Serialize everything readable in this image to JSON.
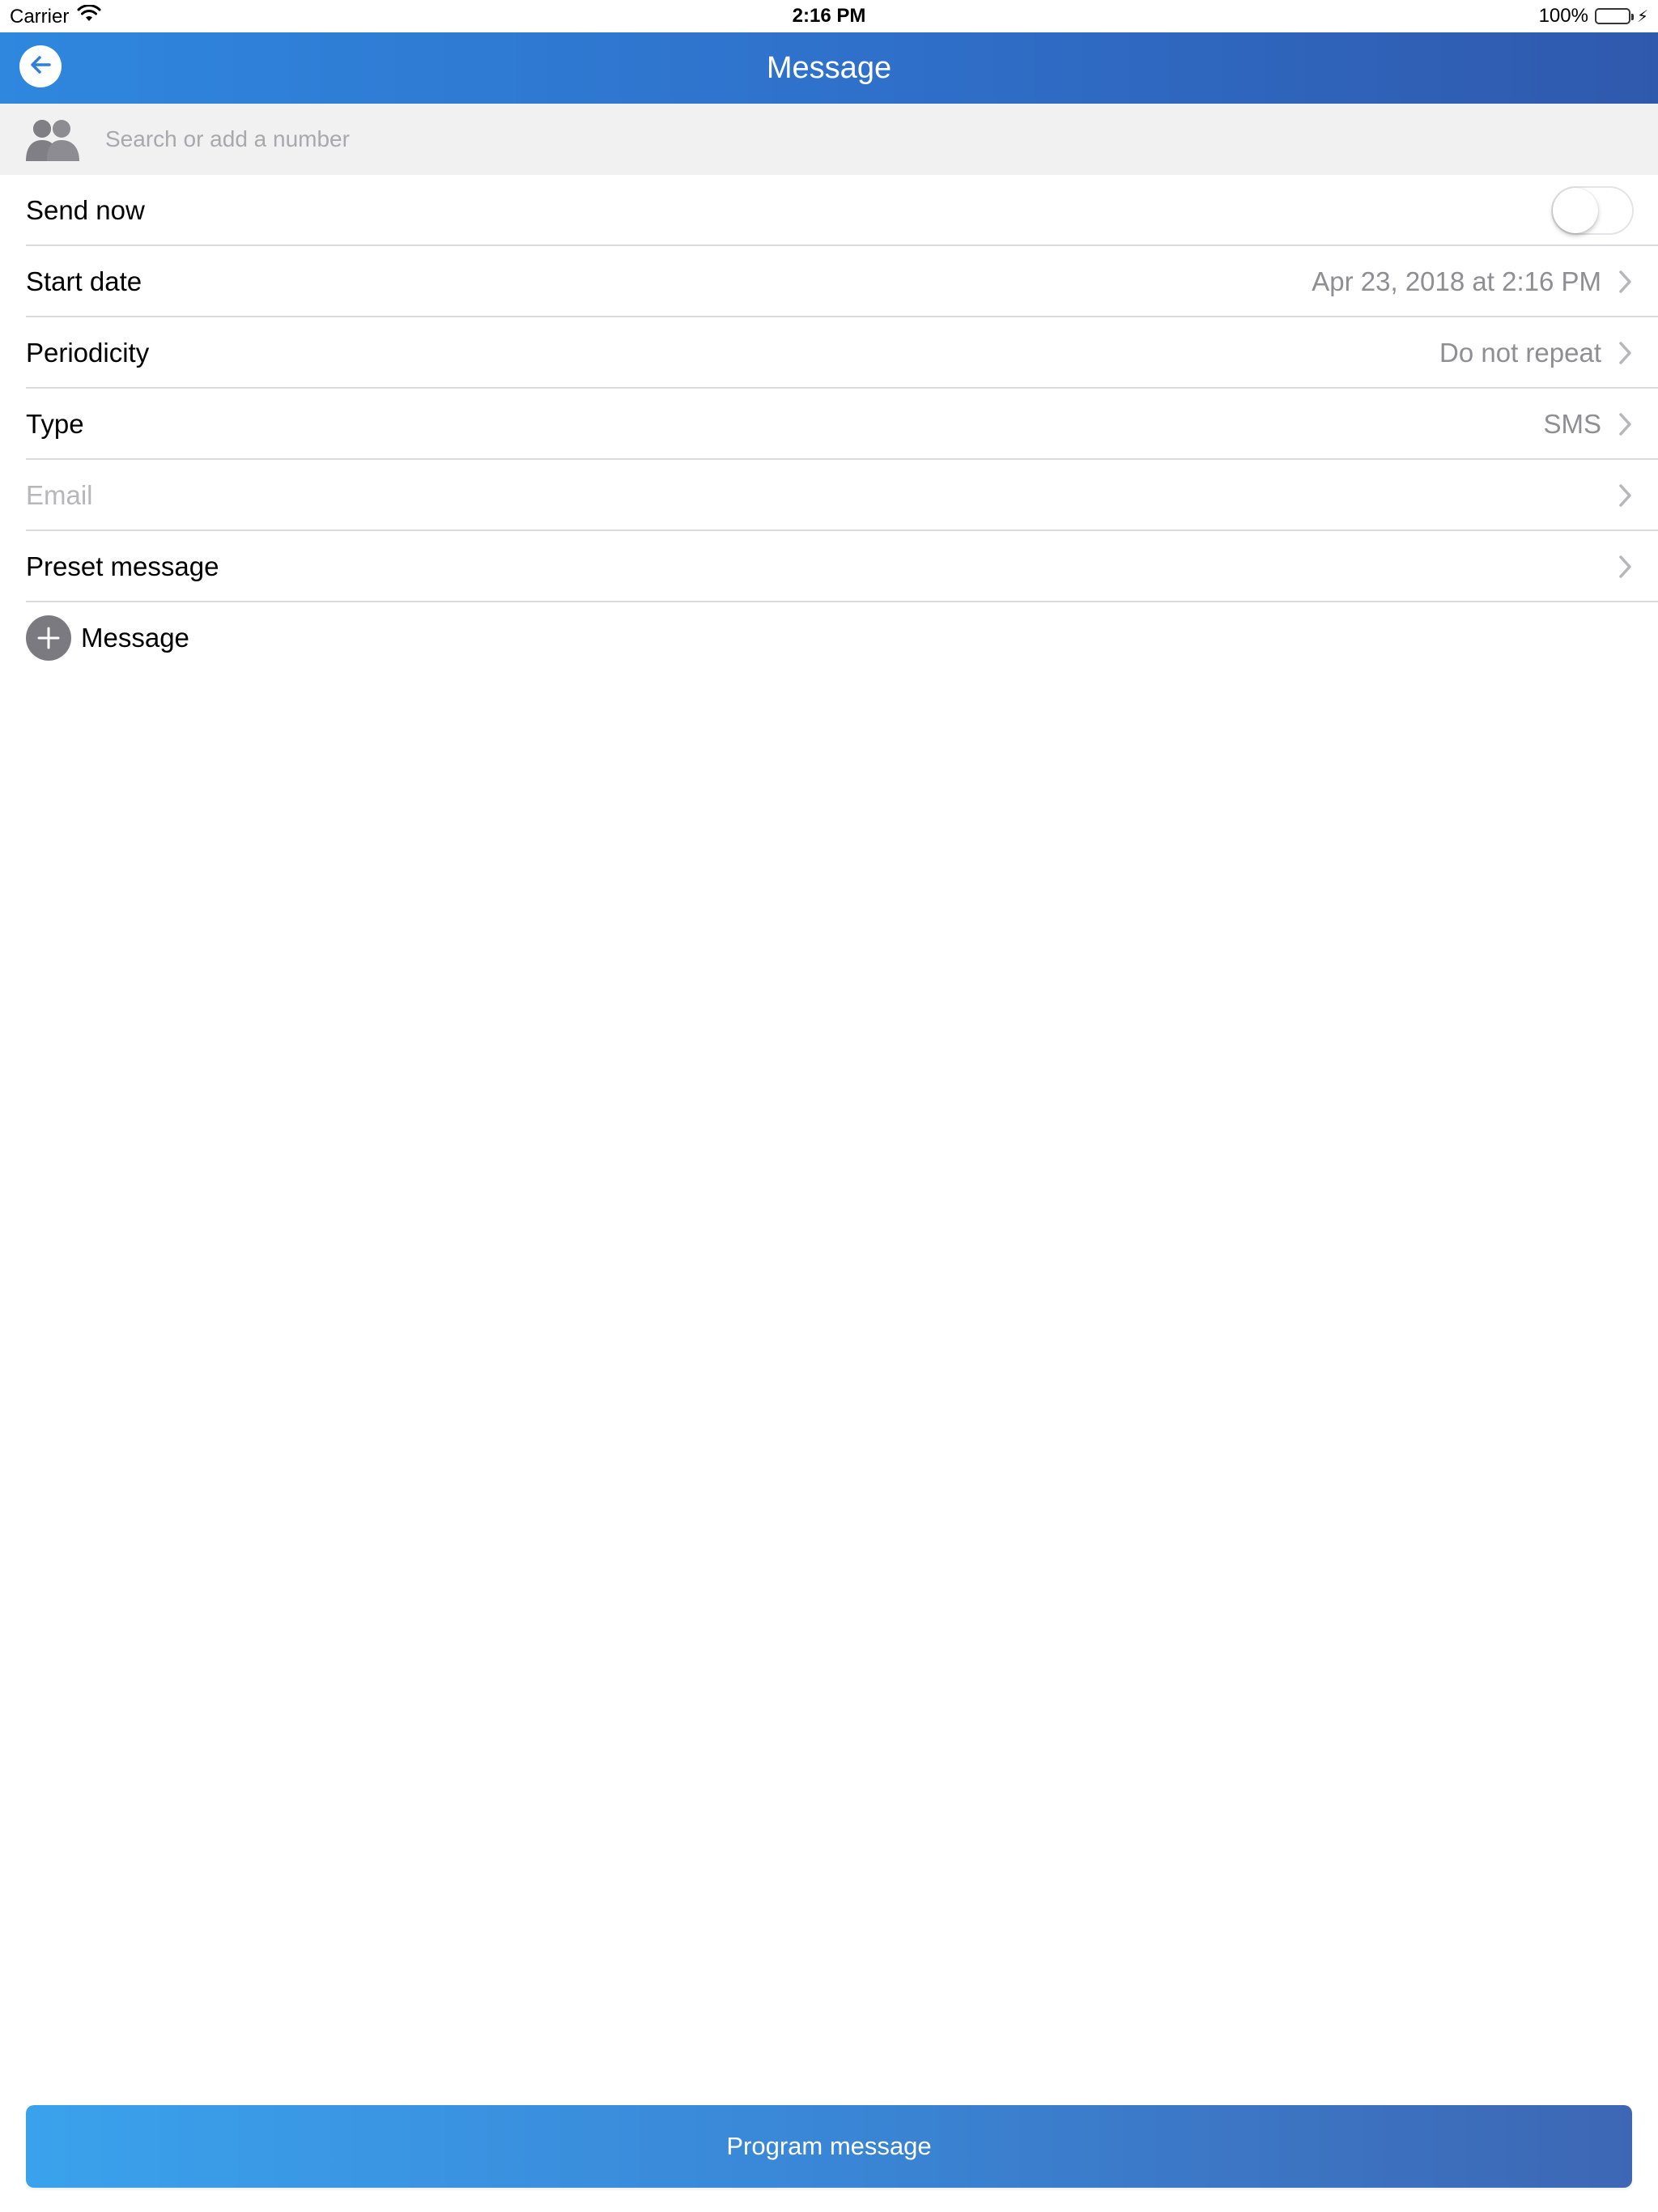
{
  "status_bar": {
    "carrier": "Carrier",
    "time": "2:16 PM",
    "battery": "100%",
    "battery_level": 1.0
  },
  "nav": {
    "title": "Message",
    "back_icon": "arrow-left-icon"
  },
  "search": {
    "placeholder": "Search or add a number",
    "value": "",
    "contacts_icon": "contacts-icon"
  },
  "form": {
    "send_now": {
      "label": "Send now",
      "enabled": false
    },
    "start_date": {
      "label": "Start date",
      "value": "Apr 23, 2018 at 2:16 PM"
    },
    "periodicity": {
      "label": "Periodicity",
      "value": "Do not repeat"
    },
    "type": {
      "label": "Type",
      "value": "SMS"
    },
    "email": {
      "label": "Email",
      "value": ""
    },
    "preset_message": {
      "label": "Preset message",
      "value": ""
    },
    "add_message": {
      "label": "Message"
    }
  },
  "footer": {
    "program_label": "Program message"
  },
  "colors": {
    "nav_start": "#2f87de",
    "nav_end": "#2f59ad",
    "button_start": "#3aa2ec",
    "button_end": "#3d67b4",
    "battery_green": "#4cd964",
    "secondary_text": "#8e8e93"
  }
}
